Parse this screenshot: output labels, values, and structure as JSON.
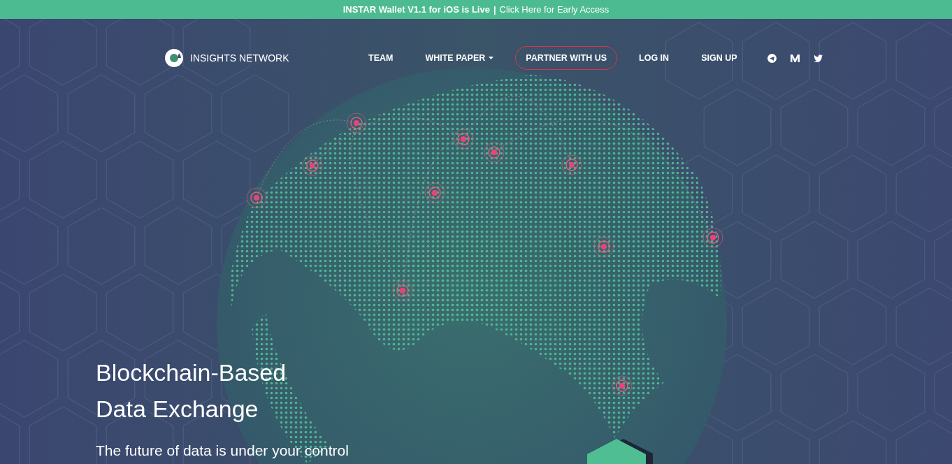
{
  "banner": {
    "bold_text": "INSTAR Wallet V1.1 for iOS is Live",
    "separator": "|",
    "link": "Click Here for Early Access"
  },
  "brand": {
    "name": "INSIGHTS NETWORK"
  },
  "nav": [
    {
      "label": "TEAM",
      "kind": "plain"
    },
    {
      "label": "WHITE PAPER",
      "kind": "dropdown"
    },
    {
      "label": "PARTNER WITH US",
      "kind": "outlined"
    },
    {
      "label": "LOG IN",
      "kind": "plain"
    },
    {
      "label": "SIGN UP",
      "kind": "plain"
    }
  ],
  "social": [
    {
      "kind": "telegram"
    },
    {
      "kind": "medium"
    },
    {
      "kind": "twitter"
    }
  ],
  "hero": {
    "title_lines": [
      "Blockchain-Based",
      "Data Exchange"
    ],
    "subtitle": "The future of data is under your control"
  }
}
